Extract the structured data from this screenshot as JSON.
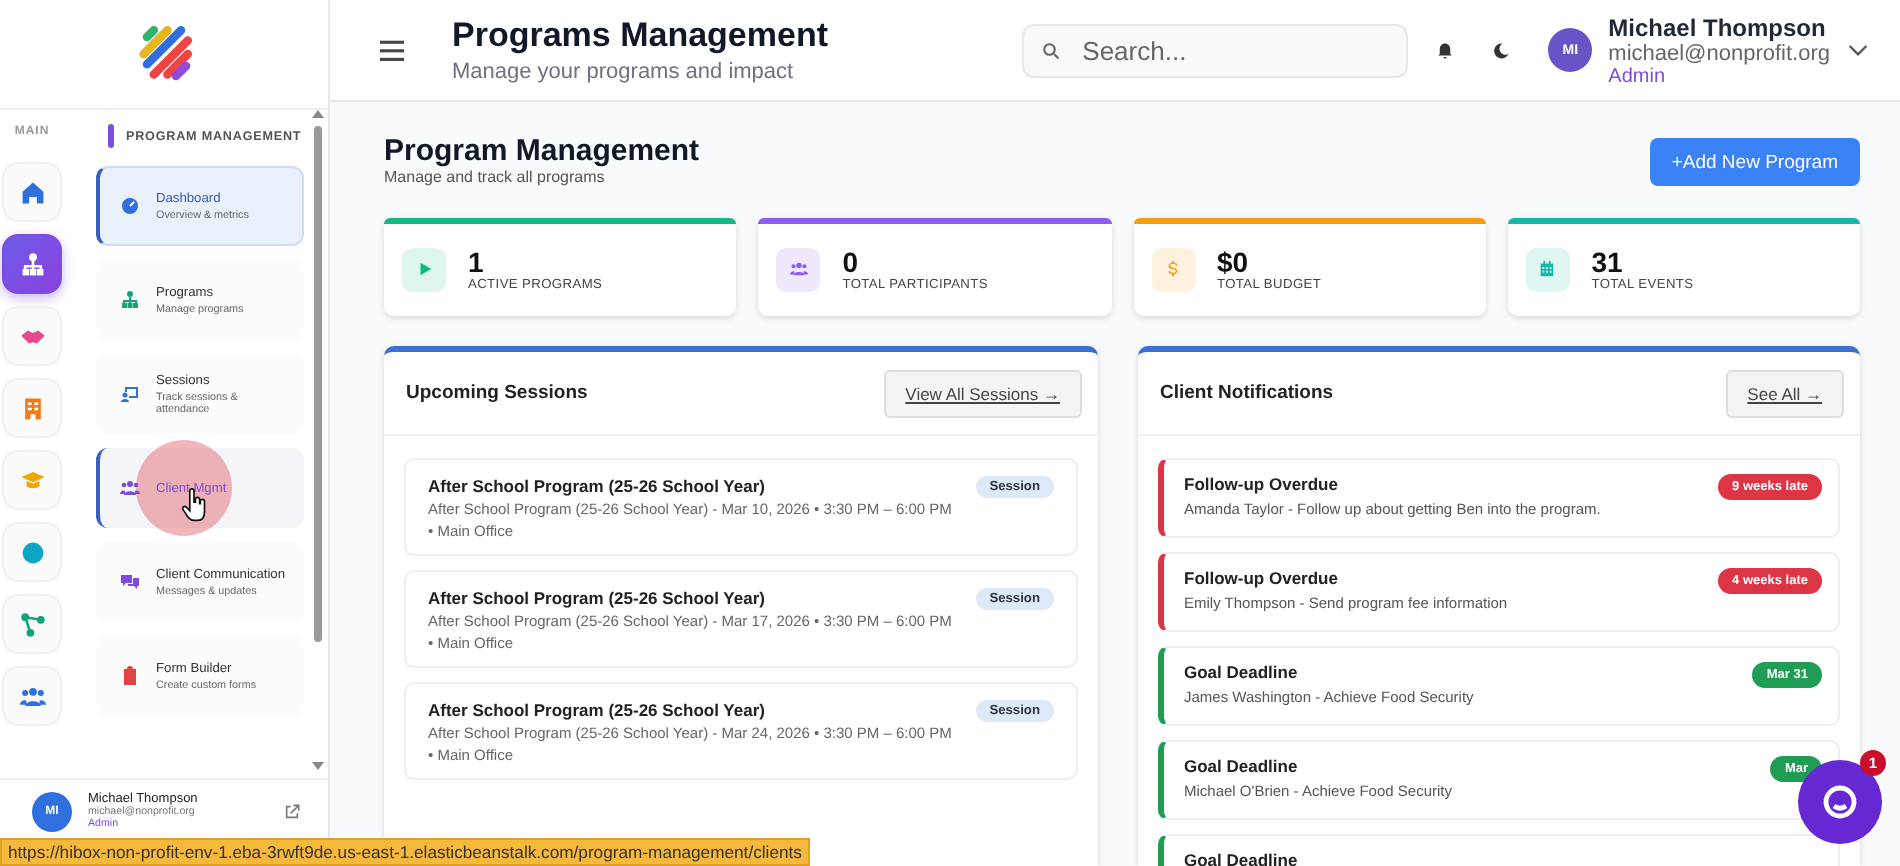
{
  "sidebar": {
    "rail_label": "MAIN",
    "rail_items": [
      {
        "selected": false
      },
      {
        "selected": true
      },
      {
        "selected": false
      },
      {
        "selected": false
      },
      {
        "selected": false
      },
      {
        "selected": false
      },
      {
        "selected": false
      },
      {
        "selected": false
      }
    ],
    "section_title": "PROGRAM MANAGEMENT",
    "items": [
      {
        "title": "Dashboard",
        "subtitle": "Overview & metrics",
        "selected": true,
        "hovered": false
      },
      {
        "title": "Programs",
        "subtitle": "Manage programs",
        "selected": false,
        "hovered": false
      },
      {
        "title": "Sessions",
        "subtitle": "Track sessions & attendance",
        "selected": false,
        "hovered": false
      },
      {
        "title": "Client Mgmt",
        "selected": false,
        "hovered": true
      },
      {
        "title": "Client Communication",
        "subtitle": "Messages & updates",
        "selected": false,
        "hovered": false
      },
      {
        "title": "Form Builder",
        "subtitle": "Create custom forms",
        "selected": false,
        "hovered": false
      }
    ],
    "user": {
      "initials": "MI",
      "name": "Michael Thompson",
      "email": "michael@nonprofit.org",
      "role": "Admin"
    }
  },
  "header": {
    "title": "Programs Management",
    "subtitle": "Manage your programs and impact",
    "search": {
      "placeholder": "Search..."
    },
    "user": {
      "initials": "MI",
      "name": "Michael Thompson",
      "email": "michael@nonprofit.org",
      "role": "Admin"
    }
  },
  "page": {
    "title": "Program Management",
    "subtitle": "Manage and track all programs",
    "add_button": "+Add New Program"
  },
  "stats": [
    {
      "value": "1",
      "label": "ACTIVE PROGRAMS",
      "color": "#10b981"
    },
    {
      "value": "0",
      "label": "TOTAL PARTICIPANTS",
      "color": "#8b5cf6"
    },
    {
      "value": "$0",
      "label": "TOTAL BUDGET",
      "color": "#f59e0b"
    },
    {
      "value": "31",
      "label": "TOTAL EVENTS",
      "color": "#14b8a6"
    }
  ],
  "sessions": {
    "title": "Upcoming Sessions",
    "link": "View All Sessions →",
    "items": [
      {
        "title": "After School Program (25-26 School Year)",
        "detail": "After School Program (25-26 School Year) - Mar 10, 2026 • 3:30 PM – 6:00 PM • Main Office",
        "tag": "Session"
      },
      {
        "title": "After School Program (25-26 School Year)",
        "detail": "After School Program (25-26 School Year) - Mar 17, 2026 • 3:30 PM – 6:00 PM • Main Office",
        "tag": "Session"
      },
      {
        "title": "After School Program (25-26 School Year)",
        "detail": "After School Program (25-26 School Year) - Mar 24, 2026 • 3:30 PM – 6:00 PM • Main Office",
        "tag": "Session"
      }
    ]
  },
  "notifications": {
    "title": "Client Notifications",
    "link": "See All →",
    "items": [
      {
        "kind": "overdue",
        "title": "Follow-up Overdue",
        "detail": "Amanda Taylor - Follow up about getting Ben into the program.",
        "badge": "9 weeks late"
      },
      {
        "kind": "overdue",
        "title": "Follow-up Overdue",
        "detail": "Emily Thompson - Send program fee information",
        "badge": "4 weeks late"
      },
      {
        "kind": "deadline",
        "title": "Goal Deadline",
        "detail": "James Washington - Achieve Food Security",
        "badge": "Mar 31"
      },
      {
        "kind": "deadline",
        "title": "Goal Deadline",
        "detail": "Michael O'Brien - Achieve Food Security",
        "badge": "Mar"
      },
      {
        "kind": "deadline",
        "title": "Goal Deadline"
      }
    ]
  },
  "chat_widget": {
    "badge": "1"
  },
  "status_bar": {
    "url": "https://hibox-non-profit-env-1.eba-3rwft9de.us-east-1.elasticbeanstalk.com/program-management/clients"
  }
}
